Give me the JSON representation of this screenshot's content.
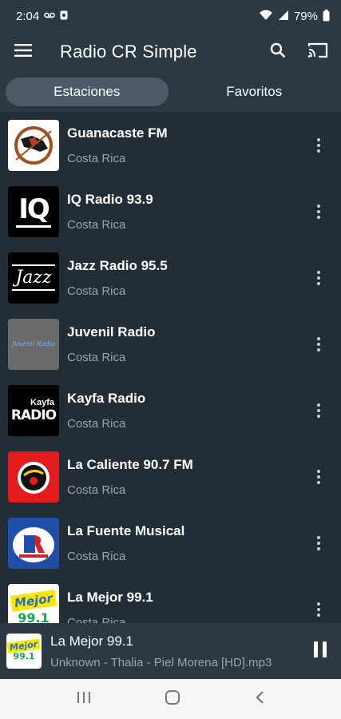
{
  "status_bar": {
    "time": "2:04",
    "battery": "79%"
  },
  "app_bar": {
    "title": "Radio CR Simple"
  },
  "tabs": [
    {
      "label": "Estaciones",
      "active": true
    },
    {
      "label": "Favoritos",
      "active": false
    }
  ],
  "stations": [
    {
      "name": "Guanacaste FM",
      "location": "Costa Rica",
      "logo_icon": "guanacaste-fm-logo"
    },
    {
      "name": "IQ Radio 93.9",
      "location": "Costa Rica",
      "logo_icon": "iq-radio-logo",
      "logo_text": "IQ"
    },
    {
      "name": "Jazz Radio 95.5",
      "location": "Costa Rica",
      "logo_icon": "jazz-radio-logo",
      "logo_text": "Jazz"
    },
    {
      "name": "Juvenil Radio",
      "location": "Costa Rica",
      "logo_icon": "juvenil-radio-logo",
      "logo_text": "Juvenil Radio"
    },
    {
      "name": "Kayfa Radio",
      "location": "Costa Rica",
      "logo_icon": "kayfa-radio-logo",
      "logo_text": "RADIO",
      "logo_text_top": "Kayfa"
    },
    {
      "name": "La Caliente 90.7 FM",
      "location": "Costa Rica",
      "logo_icon": "la-caliente-logo"
    },
    {
      "name": "La Fuente Musical",
      "location": "Costa Rica",
      "logo_icon": "la-fuente-musical-logo"
    },
    {
      "name": "La Mejor 99.1",
      "location": "Costa Rica",
      "logo_icon": "la-mejor-logo",
      "logo_text": "Mejor"
    }
  ],
  "player": {
    "station": "La Mejor 99.1",
    "track": "Unknown - Thalia - Piel Morena [HD].mp3",
    "logo_text": "Mejor"
  },
  "colors": {
    "background": "#222d36",
    "bar": "#2c3842",
    "active_tab": "#4b5a66",
    "subtext": "#9aa4ad",
    "nav_bar": "#f6f6f6"
  }
}
